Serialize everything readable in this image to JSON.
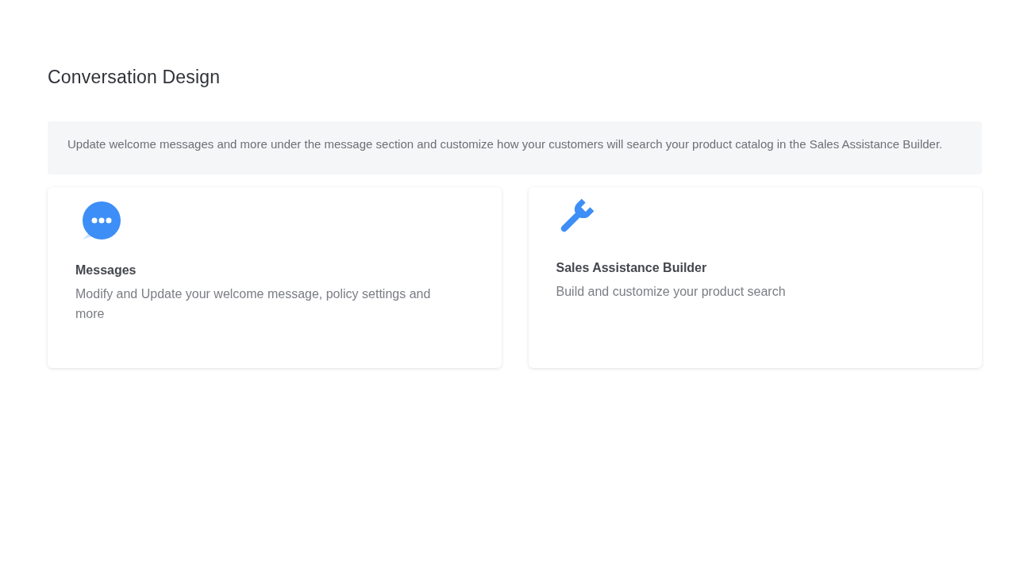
{
  "page": {
    "title": "Conversation Design"
  },
  "intro": "Update welcome messages and more under the message section and customize how your customers will search your product catalog in the Sales Assistance Builder.",
  "cards": [
    {
      "kind": "chat",
      "title": "Messages",
      "description": "Modify and Update your welcome message, policy settings and more"
    },
    {
      "kind": "wrench",
      "title": "Sales Assistance Builder",
      "description": "Build and customize your product search"
    }
  ]
}
